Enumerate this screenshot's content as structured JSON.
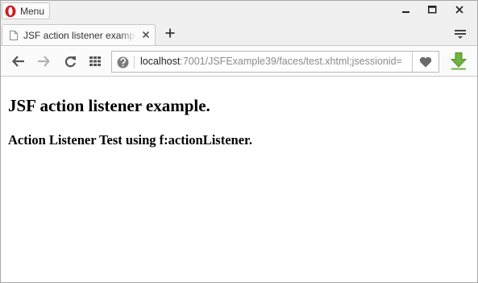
{
  "browser": {
    "menu_label": "Menu",
    "icons": {
      "logo": "opera-logo-icon",
      "minimize": "minimize-icon",
      "maximize": "maximize-icon",
      "close": "close-icon",
      "page": "document-icon",
      "tab_close": "tab-close-icon",
      "new_tab": "plus-icon",
      "tab_menu": "tab-menu-icon",
      "back": "back-arrow-icon",
      "forward": "forward-arrow-icon",
      "reload": "reload-icon",
      "speed_dial": "grid-icon",
      "site_info": "site-info-icon",
      "bookmark": "heart-icon",
      "download": "download-arrow-icon"
    },
    "colors": {
      "accent_red": "#d11b20",
      "download_green": "#6db33f"
    }
  },
  "tab": {
    "title": "JSF action listener example."
  },
  "address": {
    "host": "localhost",
    "rest": ":7001/JSFExample39/faces/test.xhtml;jsessionid="
  },
  "page": {
    "heading": "JSF action listener example.",
    "subheading": "Action Listener Test using f:actionListener."
  }
}
